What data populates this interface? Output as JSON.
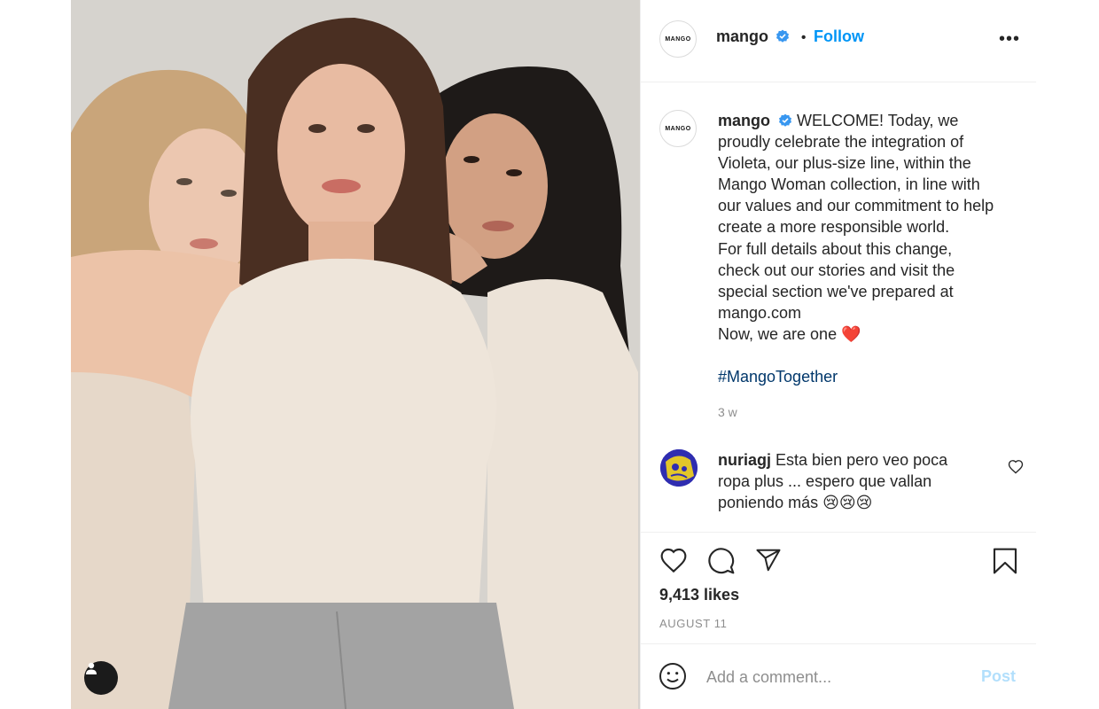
{
  "post": {
    "username": "mango",
    "avatar_text": "MANGO",
    "follow_label": "Follow",
    "separator": "•",
    "more_label": "•••",
    "caption_lines": [
      "WELCOME! Today, we",
      "proudly celebrate the integration of",
      "Violeta, our plus-size line, within the",
      "Mango Woman collection, in line with",
      "our values and our commitment to help",
      "create a more responsible world.",
      "For full details about this change,",
      "check out our stories and visit the",
      "special section we've prepared at",
      "mango.com",
      "Now, we are one ❤️"
    ],
    "hashtag": "#MangoTogether",
    "time_ago": "3 w",
    "likes": "9,413 likes",
    "date": "AUGUST 11"
  },
  "comment": {
    "username": "nuriagj",
    "lines": [
      "Esta bien pero veo poca",
      "ropa plus ... espero que vallan",
      "poniendo más 😢😢😢"
    ]
  },
  "comment_box": {
    "placeholder": "Add a comment...",
    "post_label": "Post"
  },
  "colors": {
    "accent": "#0095f6",
    "hashtag": "#00376b",
    "muted": "#8e8e8e",
    "post_disabled": "#b2dffc",
    "verified": "#3897f0"
  },
  "icons": [
    "heart-icon",
    "comment-icon",
    "share-icon",
    "bookmark-icon",
    "emoji-icon",
    "user-tag-icon",
    "more-icon",
    "verified-badge-icon"
  ]
}
